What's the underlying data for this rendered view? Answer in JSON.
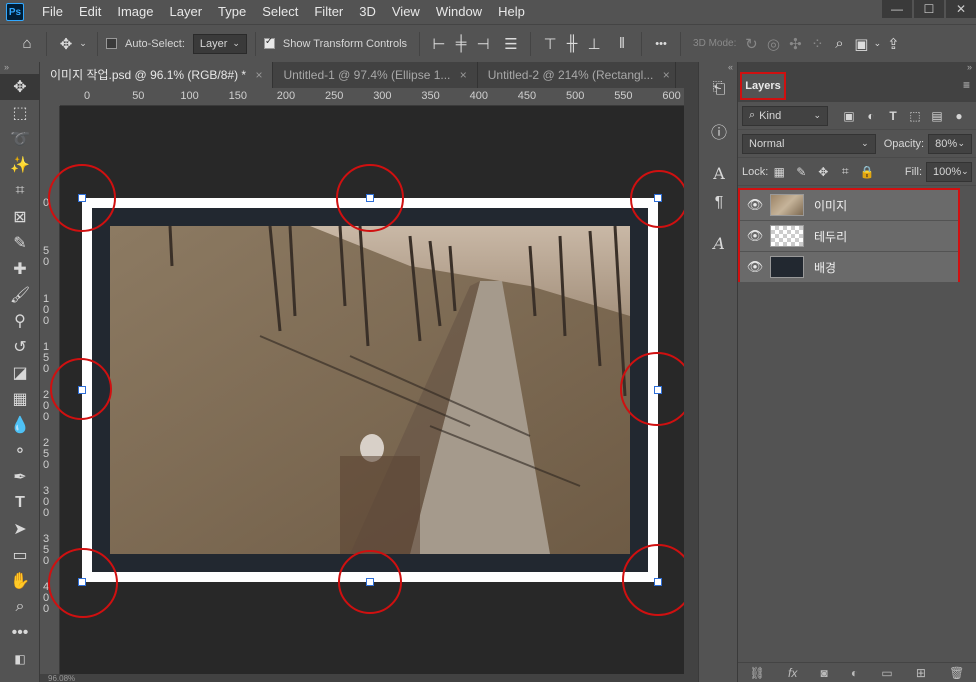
{
  "app": {
    "logo": "Ps"
  },
  "menu": [
    "File",
    "Edit",
    "Image",
    "Layer",
    "Type",
    "Select",
    "Filter",
    "3D",
    "View",
    "Window",
    "Help"
  ],
  "window_controls": {
    "minimize": "—",
    "restore": "☐",
    "close": "✕"
  },
  "options_bar": {
    "auto_select_label": "Auto-Select:",
    "auto_select_target": "Layer",
    "show_transform_label": "Show Transform Controls",
    "three_d_mode_label": "3D Mode:",
    "more_label": "•••"
  },
  "tabs": [
    {
      "label": "이미지 작업.psd @ 96.1% (RGB/8#) *",
      "close": "×"
    },
    {
      "label": "Untitled-1 @ 97.4% (Ellipse 1...",
      "close": "×"
    },
    {
      "label": "Untitled-2 @ 214% (Rectangl...",
      "close": "×"
    }
  ],
  "ruler_h_labels": [
    "0",
    "50",
    "100",
    "150",
    "200",
    "250",
    "300",
    "350",
    "400",
    "450",
    "500",
    "550",
    "600"
  ],
  "ruler_v_labels": [
    "0",
    "5\n0",
    "1\n0\n0",
    "1\n5\n0",
    "2\n0\n0",
    "2\n5\n0",
    "3\n0\n0",
    "3\n5\n0",
    "4\n0\n0"
  ],
  "layers_panel": {
    "title": "Layers",
    "filter_kind": "Kind",
    "blend_mode": "Normal",
    "opacity_label": "Opacity:",
    "opacity_value": "80%",
    "lock_label": "Lock:",
    "fill_label": "Fill:",
    "fill_value": "100%",
    "layers": [
      {
        "name": "이미지",
        "thumb": "photo"
      },
      {
        "name": "테두리",
        "thumb": "transparent"
      },
      {
        "name": "배경",
        "thumb": "dark"
      }
    ]
  },
  "status_bar": {
    "zoom": "96.08%"
  },
  "colors": {
    "accent_highlight": "#d01010",
    "handle_border": "#2f6fd8",
    "frame_white": "#ffffff",
    "frame_dark": "#222830"
  }
}
